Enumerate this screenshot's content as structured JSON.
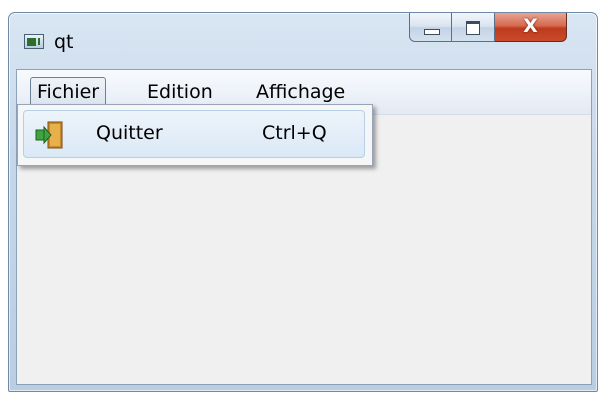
{
  "window": {
    "title": "qt",
    "controls": {
      "minimize_icon": "minimize-icon",
      "maximize_icon": "maximize-icon",
      "close_icon": "close-icon",
      "close_glyph": "X"
    },
    "accent_close": "#c94a2c"
  },
  "menubar": {
    "items": [
      {
        "label": "Fichier",
        "active": true
      },
      {
        "label": "Edition",
        "active": false
      },
      {
        "label": "Affichage",
        "active": false
      }
    ]
  },
  "dropdown": {
    "items": [
      {
        "icon": "exit-door-icon",
        "label": "Quitter",
        "shortcut": "Ctrl+Q"
      }
    ]
  }
}
